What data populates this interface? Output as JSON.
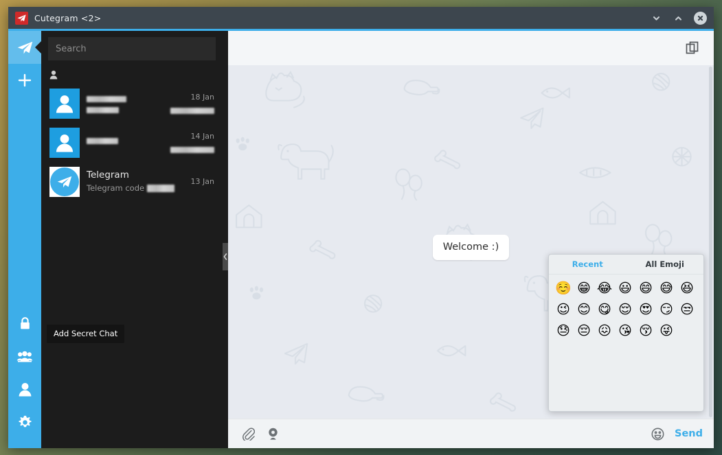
{
  "window": {
    "title": "Cutegram <2>",
    "logo_icon": "paper-plane-icon",
    "accent_color": "#3daee9",
    "titlebar_color": "#3d464e",
    "controls": [
      {
        "name": "minimize-button",
        "icon": "chevron-down-icon"
      },
      {
        "name": "maximize-button",
        "icon": "chevron-up-icon"
      },
      {
        "name": "close-button",
        "icon": "close-icon"
      }
    ]
  },
  "rail": {
    "background_color": "#3daee9",
    "top_items": [
      {
        "name": "chats-button",
        "icon": "paper-plane-icon",
        "active": true
      },
      {
        "name": "add-chat-button",
        "icon": "plus-icon",
        "active": false
      }
    ],
    "bottom_items": [
      {
        "name": "add-secret-chat-button",
        "icon": "lock-icon"
      },
      {
        "name": "add-group-button",
        "icon": "group-icon"
      },
      {
        "name": "profile-button",
        "icon": "person-icon"
      },
      {
        "name": "settings-button",
        "icon": "gear-icon"
      }
    ]
  },
  "tooltip": {
    "text": "Add Secret Chat",
    "visible": true
  },
  "search": {
    "placeholder": "Search",
    "value": ""
  },
  "chat_list": {
    "section_icon": "person-icon",
    "rows": [
      {
        "name_redacted": true,
        "title": "",
        "subtitle": "",
        "date": "18 Jan",
        "avatar": "person-avatar",
        "sub_redacted": true
      },
      {
        "name_redacted": true,
        "title": "",
        "subtitle": "",
        "date": "14 Jan",
        "avatar": "person-avatar",
        "sub_redacted": true
      },
      {
        "name_redacted": false,
        "title": "Telegram",
        "subtitle": "Telegram code",
        "date": "13 Jan",
        "avatar": "telegram-avatar",
        "sub_redacted": true
      }
    ]
  },
  "splitter": {
    "handle_icon": "chevron-left-icon"
  },
  "conversation": {
    "header": {
      "copy_button_icon": "copy-icon"
    },
    "messages": [
      {
        "text": "Welcome :)",
        "side": "incoming"
      }
    ],
    "background": "pet-doodle-pattern"
  },
  "emoji_panel": {
    "visible": true,
    "tabs": [
      {
        "label": "Recent",
        "active": true
      },
      {
        "label": "All Emoji",
        "active": false
      }
    ],
    "emojis": [
      "☺️",
      "😁",
      "😂",
      "😃",
      "😄",
      "😅",
      "😆",
      "😉",
      "😊",
      "😋",
      "😌",
      "😍",
      "😏",
      "😒",
      "😓",
      "😔",
      "😖",
      "😘",
      "😚",
      "😜"
    ]
  },
  "composer": {
    "attach_icon": "paperclip-icon",
    "camera_icon": "webcam-icon",
    "emoji_icon": "smiley-icon",
    "send_label": "Send",
    "send_color": "#3daee9"
  }
}
